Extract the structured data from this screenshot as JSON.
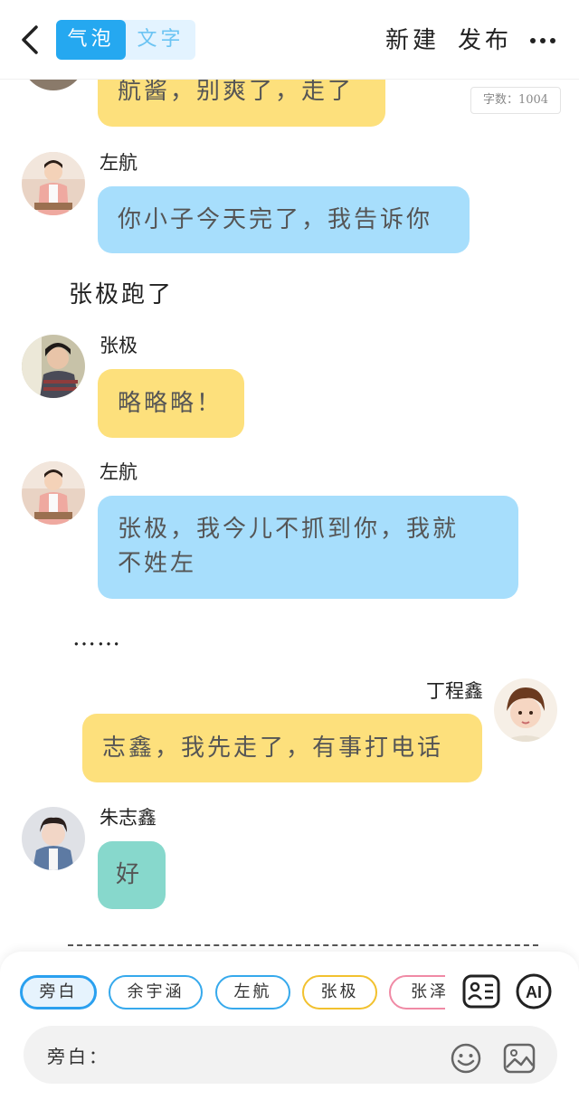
{
  "header": {
    "tabs": [
      "气泡",
      "文字"
    ],
    "new_label": "新建",
    "publish_label": "发布"
  },
  "word_count": "字数：1004",
  "messages": [
    {
      "type": "bubble",
      "text": "航酱，别爽了，走了",
      "color": "#fde07c"
    },
    {
      "type": "bubble",
      "speaker": "左航",
      "text": "你小子今天完了，我告诉你",
      "color": "#a7defc"
    },
    {
      "type": "narration",
      "text": "张极跑了"
    },
    {
      "type": "bubble",
      "speaker": "张极",
      "text": "略略略！",
      "color": "#fde07c"
    },
    {
      "type": "bubble",
      "speaker": "左航",
      "lines": [
        "张极，我今儿不抓到你，我就",
        "不姓左"
      ],
      "color": "#a7defc"
    },
    {
      "type": "narration",
      "text": "……"
    },
    {
      "type": "bubble",
      "speaker": "丁程鑫",
      "text": "志鑫，我先走了，有事打电话",
      "color": "#fde07c",
      "align": "right"
    },
    {
      "type": "bubble",
      "speaker": "朱志鑫",
      "text": "好",
      "color": "#87d8cc"
    }
  ],
  "characters": [
    {
      "label": "旁白",
      "color": "#2aa0ef",
      "selected": true
    },
    {
      "label": "余宇涵",
      "color": "#36a9ec"
    },
    {
      "label": "左航",
      "color": "#36a9ec"
    },
    {
      "label": "张极",
      "color": "#f2c12e"
    },
    {
      "label": "张泽",
      "color": "#f08aa5"
    }
  ],
  "input": {
    "label": "旁白："
  },
  "icons": [
    "back-icon",
    "more-icon",
    "character-card-icon",
    "ai-icon",
    "emoji-icon",
    "image-icon"
  ]
}
